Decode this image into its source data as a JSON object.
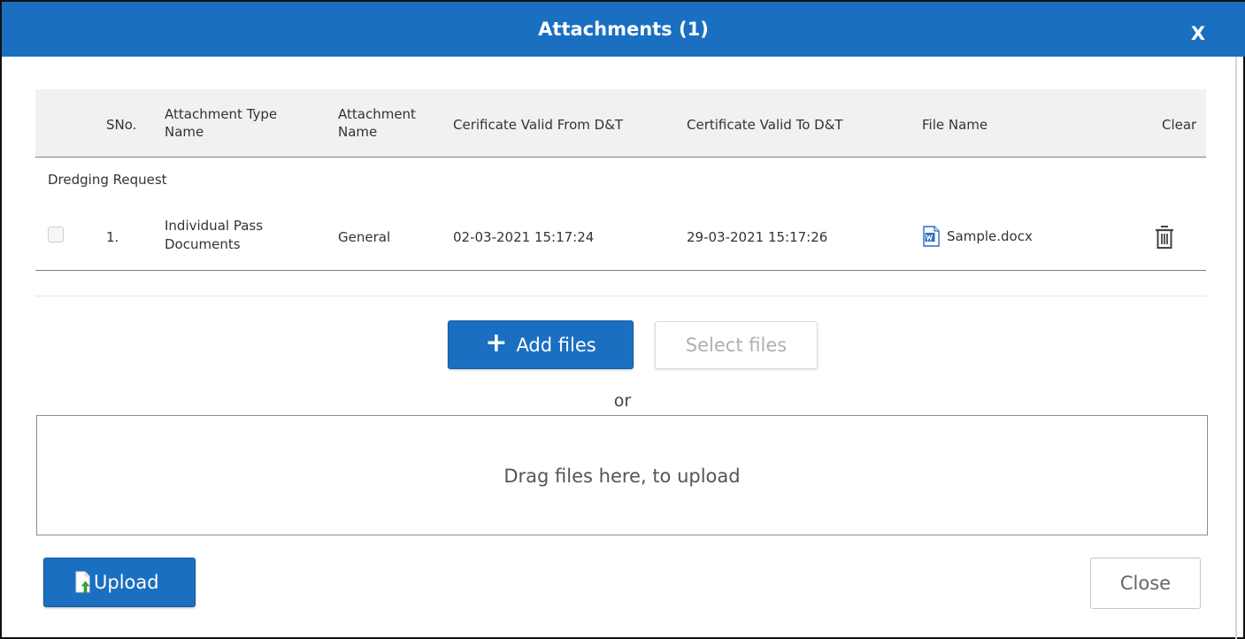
{
  "dialog": {
    "title": "Attachments (1)",
    "close_label": "X"
  },
  "table": {
    "headers": {
      "sno": "SNo.",
      "attachment_type_name": "Attachment Type Name",
      "attachment_name": "Attachment Name",
      "valid_from": "Cerificate Valid From D&T",
      "valid_to": "Certificate Valid To D&T",
      "file_name": "File Name",
      "clear": "Clear"
    },
    "group_label": "Dredging Request",
    "rows": [
      {
        "sno": "1.",
        "attachment_type_name": "Individual Pass Documents",
        "attachment_name": "General",
        "valid_from": "02-03-2021 15:17:24",
        "valid_to": "29-03-2021 15:17:26",
        "file_name": "Sample.docx",
        "file_icon": "word-doc-icon",
        "clear_icon": "trash-icon"
      }
    ]
  },
  "uploader": {
    "add_files_label": "Add files",
    "select_files_label": "Select files",
    "or_text": "or",
    "dropzone_text": "Drag files here, to upload"
  },
  "footer": {
    "upload_label": "Upload",
    "close_label": "Close"
  },
  "colors": {
    "primary": "#1a6fc1",
    "header_bg": "#f1f1f1"
  }
}
